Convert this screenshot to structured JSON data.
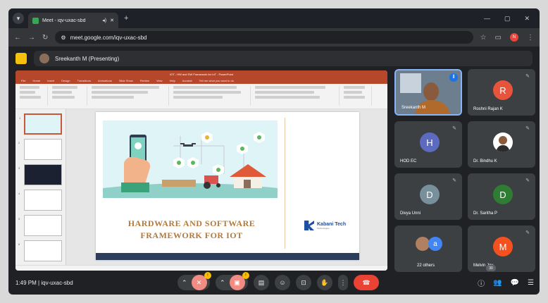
{
  "browser": {
    "tab_title": "Meet - iqv-uxac-sbd",
    "tab_media_icon": "speaker-icon",
    "url": "meet.google.com/iqv-uxac-sbd",
    "profile_initial": "N"
  },
  "meet": {
    "presenter_banner": "Sreekanth M (Presenting)",
    "time": "1:49 PM",
    "separator": "|",
    "meeting_code": "iqv-uxac-sbd",
    "participant_count": "30",
    "hands_raised_badge": "1",
    "mic_badge": "!"
  },
  "powerpoint": {
    "window_title": "IOT - HW and SW Framework for IoT - PowerPoint",
    "menu": [
      "File",
      "Home",
      "Insert",
      "Design",
      "Transitions",
      "Animations",
      "Slide Show",
      "Review",
      "View",
      "Help",
      "Acrobat",
      "Tell me what you want to do"
    ],
    "slide": {
      "title_line1": "HARDWARE AND SOFTWARE",
      "title_line2": "FRAMEWORK FOR IOT",
      "brand_name": "Kabani Tech",
      "brand_sub": "Technologies"
    }
  },
  "participants": [
    {
      "name": "Sreekanth M",
      "initial": "",
      "color": ""
    },
    {
      "name": "Roshni Rajan K",
      "initial": "R",
      "color": "#e8543b"
    },
    {
      "name": "HOD EC",
      "initial": "H",
      "color": "#5c6bc0"
    },
    {
      "name": "Dr. Bindhu K",
      "initial": "",
      "color": ""
    },
    {
      "name": "Divya Unni",
      "initial": "D",
      "color": "#78909c"
    },
    {
      "name": "Dr. Saritha P",
      "initial": "D",
      "color": "#2e7d32"
    },
    {
      "name": "22 others",
      "initial": "a",
      "color": "#4285f4"
    },
    {
      "name": "Melvin Joy",
      "initial": "M",
      "color": "#f4511e"
    }
  ]
}
